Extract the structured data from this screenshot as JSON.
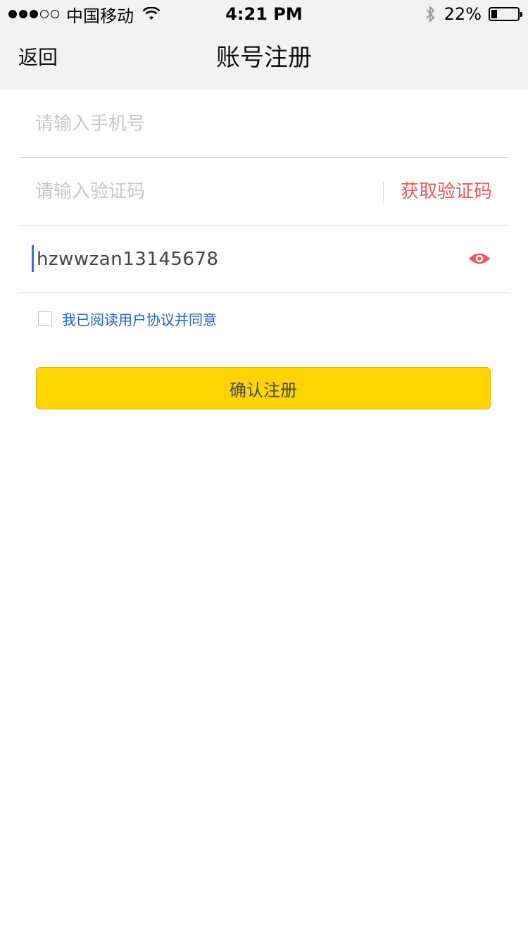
{
  "status_bar": {
    "carrier": "中国移动",
    "time": "4:21 PM",
    "battery_percent_label": "22%",
    "battery_level": 0.22,
    "signal_bars_filled": 3,
    "signal_bars_total": 5,
    "icons": [
      "signal-dots-icon",
      "wifi-icon",
      "bluetooth-icon",
      "battery-icon"
    ]
  },
  "nav": {
    "back_label": "返回",
    "title": "账号注册"
  },
  "form": {
    "phone": {
      "value": "",
      "placeholder": "请输入手机号"
    },
    "code": {
      "value": "",
      "placeholder": "请输入验证码",
      "get_code_label": "获取验证码"
    },
    "password": {
      "value": "hzwwzan13145678",
      "icon": "eye-icon"
    },
    "agreement": {
      "label": "我已阅读用户协议并同意",
      "checked": false
    },
    "confirm_label": "确认注册"
  },
  "colors": {
    "accent_yellow": "#ffd400",
    "get_code_red": "#f05a5a",
    "eye_red": "#f05a5a",
    "link_blue": "#1f63c6",
    "caret_blue": "#4169e1",
    "nav_background": "#f2f2f2"
  }
}
